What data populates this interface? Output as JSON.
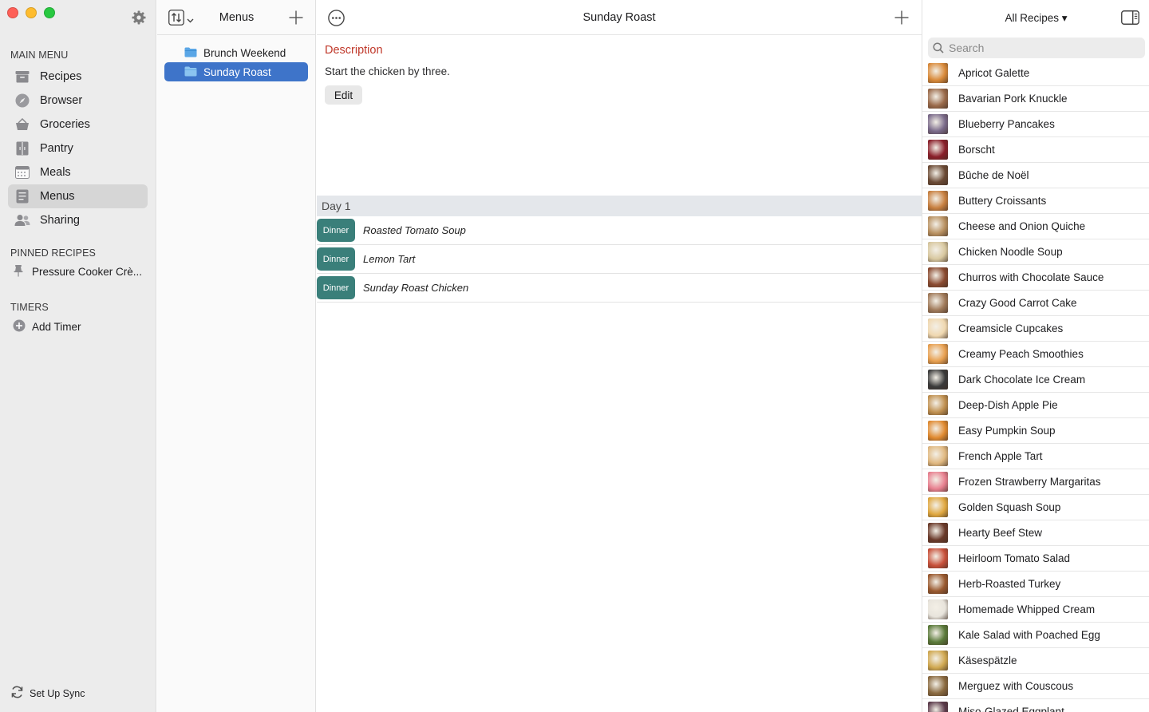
{
  "sidebar": {
    "main_menu_label": "MAIN MENU",
    "items": [
      {
        "label": "Recipes",
        "icon": "archive-box-icon"
      },
      {
        "label": "Browser",
        "icon": "compass-icon"
      },
      {
        "label": "Groceries",
        "icon": "basket-icon"
      },
      {
        "label": "Pantry",
        "icon": "cabinet-icon"
      },
      {
        "label": "Meals",
        "icon": "calendar-icon"
      },
      {
        "label": "Menus",
        "icon": "menu-book-icon",
        "selected": true
      },
      {
        "label": "Sharing",
        "icon": "people-icon"
      }
    ],
    "pinned_label": "PINNED RECIPES",
    "pinned_items": [
      "Pressure Cooker Crè..."
    ],
    "timers_label": "TIMERS",
    "add_timer": "Add Timer",
    "sync": "Set Up Sync"
  },
  "menus": {
    "title": "Menus",
    "folders": [
      {
        "label": "Brunch Weekend",
        "selected": false
      },
      {
        "label": "Sunday Roast",
        "selected": true
      }
    ]
  },
  "main": {
    "title": "Sunday Roast",
    "description_heading": "Description",
    "description_text": "Start the chicken by three.",
    "edit_label": "Edit",
    "days": [
      {
        "label": "Day 1",
        "meals": [
          {
            "type": "Dinner",
            "recipe": "Roasted Tomato Soup"
          },
          {
            "type": "Dinner",
            "recipe": "Lemon Tart"
          },
          {
            "type": "Dinner",
            "recipe": "Sunday Roast Chicken"
          }
        ]
      }
    ]
  },
  "recipes": {
    "filter_label": "All Recipes ▾",
    "search_placeholder": "Search",
    "list": [
      {
        "name": "Apricot Galette",
        "color": "#d98a3a"
      },
      {
        "name": "Bavarian Pork Knuckle",
        "color": "#9a6a4a"
      },
      {
        "name": "Blueberry Pancakes",
        "color": "#7a6a8a"
      },
      {
        "name": "Borscht",
        "color": "#8a1f2a"
      },
      {
        "name": "Bûche de Noël",
        "color": "#6b4a35"
      },
      {
        "name": "Buttery Croissants",
        "color": "#c88040"
      },
      {
        "name": "Cheese and Onion Quiche",
        "color": "#b89060"
      },
      {
        "name": "Chicken Noodle Soup",
        "color": "#d8c8a0"
      },
      {
        "name": "Churros with Chocolate Sauce",
        "color": "#8a4a30"
      },
      {
        "name": "Crazy Good Carrot Cake",
        "color": "#a07a5a"
      },
      {
        "name": "Creamsicle Cupcakes",
        "color": "#f0d8b0"
      },
      {
        "name": "Creamy Peach Smoothies",
        "color": "#e8a050"
      },
      {
        "name": "Dark Chocolate Ice Cream",
        "color": "#3a3a3a"
      },
      {
        "name": "Deep-Dish Apple Pie",
        "color": "#c09050"
      },
      {
        "name": "Easy Pumpkin Soup",
        "color": "#e08a30"
      },
      {
        "name": "French Apple Tart",
        "color": "#e0b880"
      },
      {
        "name": "Frozen Strawberry Margaritas",
        "color": "#e88090"
      },
      {
        "name": "Golden Squash Soup",
        "color": "#e0a840"
      },
      {
        "name": "Hearty Beef Stew",
        "color": "#6a3a2a"
      },
      {
        "name": "Heirloom Tomato Salad",
        "color": "#c8503a"
      },
      {
        "name": "Herb-Roasted Turkey",
        "color": "#9a5a30"
      },
      {
        "name": "Homemade Whipped Cream",
        "color": "#e8e4dc"
      },
      {
        "name": "Kale Salad with Poached Egg",
        "color": "#5a7a3a"
      },
      {
        "name": "Käsespätzle",
        "color": "#d0a850"
      },
      {
        "name": "Merguez with Couscous",
        "color": "#8a6a40"
      },
      {
        "name": "Miso-Glazed Eggplant",
        "color": "#5a3a4a"
      }
    ]
  }
}
